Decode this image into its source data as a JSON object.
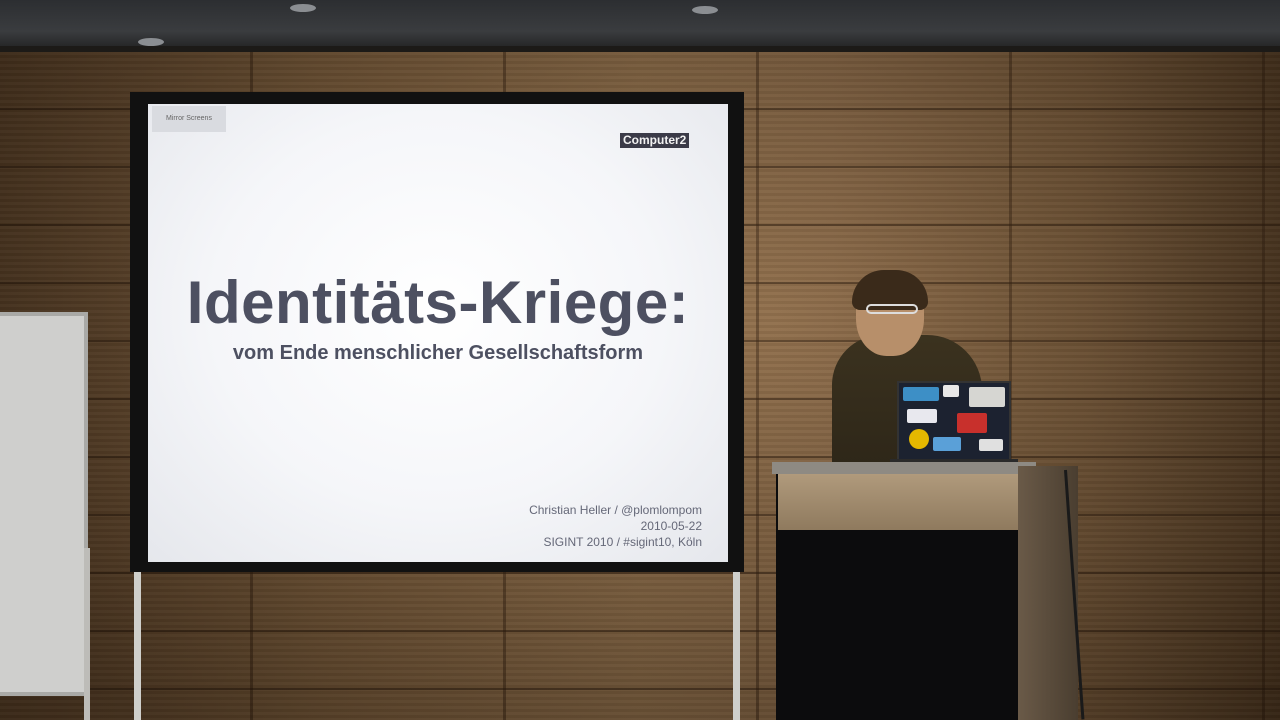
{
  "slide": {
    "mirror_label": "Mirror Screens",
    "brand_badge": "Computer2",
    "title": "Identitäts-Kriege:",
    "subtitle": "vom Ende menschlicher Gesellschaftsform",
    "meta": [
      "Christian Heller / @plomlompom",
      "2010-05-22",
      "SIGINT 2010 / #sigint10, Köln"
    ]
  },
  "colors": {
    "slide_text": "#4d5061",
    "wall_wood": "#8c6a45",
    "badge_bg": "#3b3b48"
  }
}
